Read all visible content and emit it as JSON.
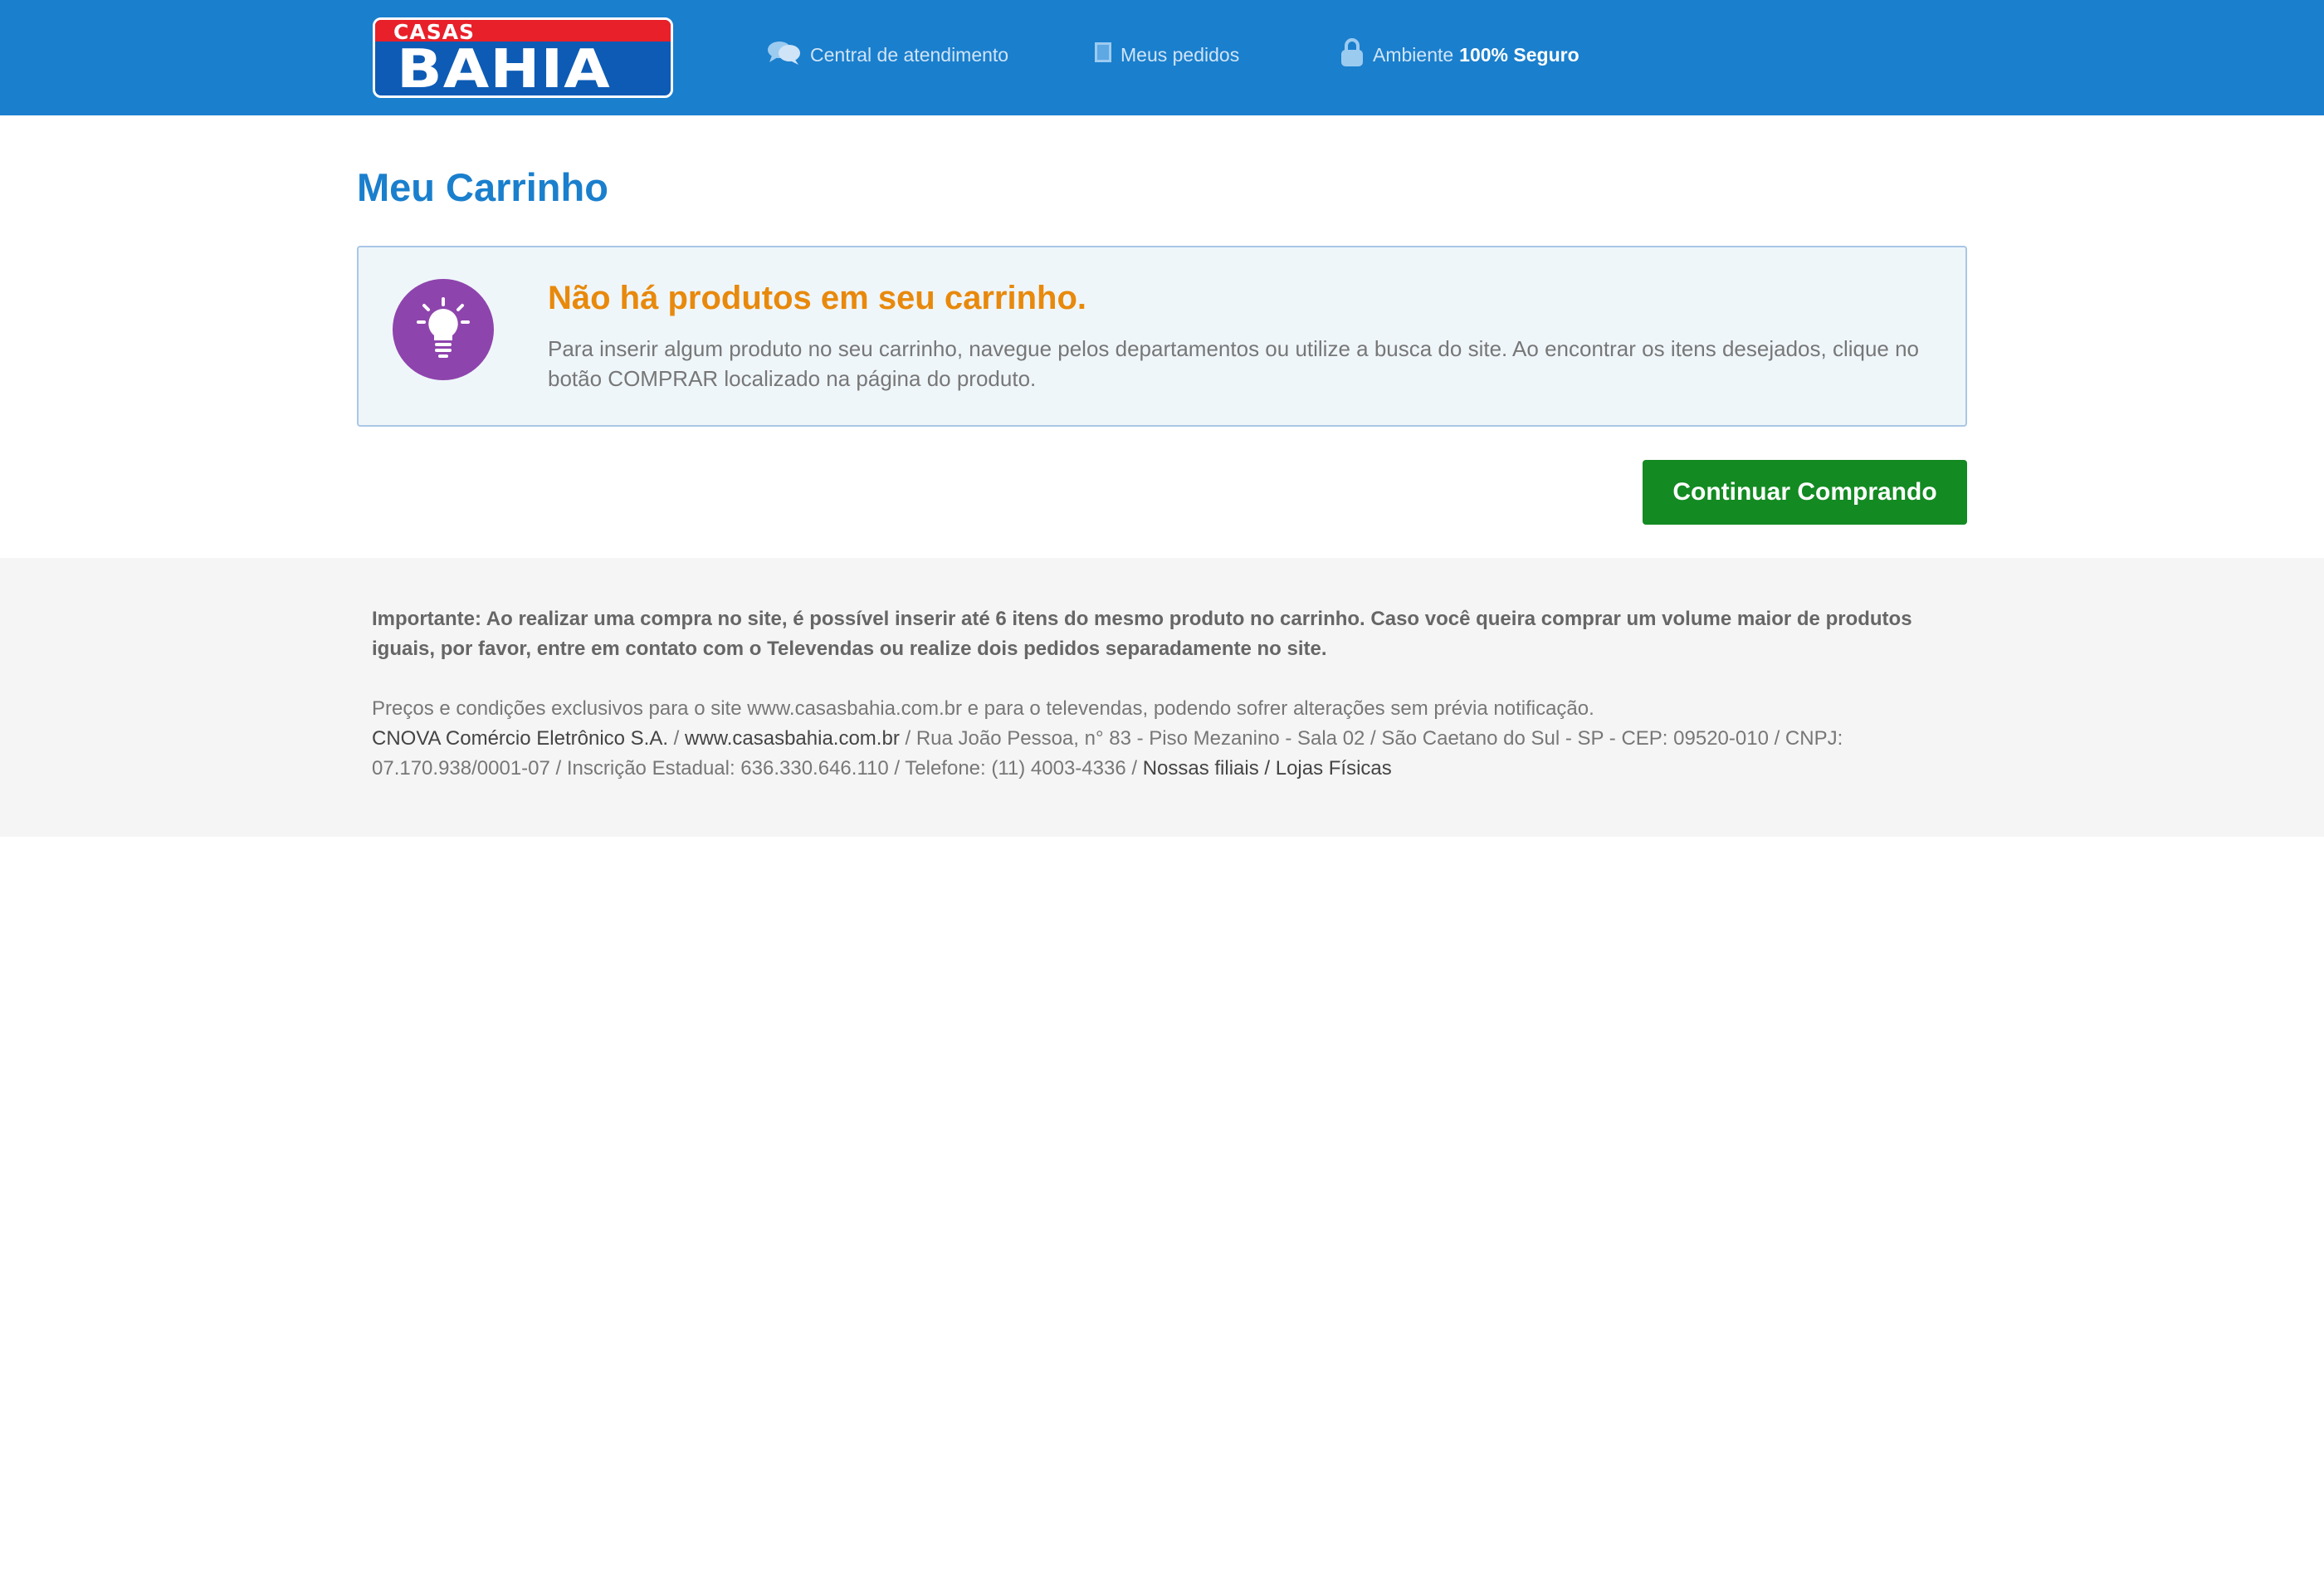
{
  "header": {
    "logo": {
      "top_text": "CASAS",
      "main_text": "BAHIA"
    },
    "links": {
      "atendimento": {
        "label": "Central de atendimento",
        "icon": "chat-bubbles-icon"
      },
      "pedidos": {
        "label": "Meus pedidos",
        "icon": "orders-icon"
      },
      "seguro": {
        "label_prefix": "Ambiente",
        "label_bold": "100% Seguro",
        "icon": "padlock-icon"
      }
    }
  },
  "main": {
    "title": "Meu Carrinho",
    "notice": {
      "icon": "lightbulb-icon",
      "title": "Não há produtos em seu carrinho.",
      "text": "Para inserir algum produto no seu carrinho, navegue pelos departamentos ou utilize a busca do site. Ao encontrar os itens desejados, clique no botão COMPRAR localizado na página do produto."
    },
    "continue_button": "Continuar Comprando"
  },
  "footer": {
    "important": "Importante: Ao realizar uma compra no site, é possível inserir até 6 itens do mesmo produto no carrinho. Caso você queira comprar um volume maior de produtos iguais, por favor, entre em contato com o Televendas ou realize dois pedidos separadamente no site.",
    "prices": "Preços e condições exclusivos para o site www.casasbahia.com.br e para o televendas, podendo sofrer alterações sem prévia notificação.",
    "company_link": "CNOVA Comércio Eletrônico S.A.",
    "sep1": " / ",
    "site_link": "www.casasbahia.com.br",
    "address": " / Rua João Pessoa, n° 83 - Piso Mezanino - Sala 02 / São Caetano do Sul - SP - CEP: 09520-010 / CNPJ: 07.170.938/0001-07 / Inscrição Estadual: 636.330.646.110 / Telefone: (11) 4003-4336 / ",
    "stores_link": "Nossas filiais / Lojas Físicas"
  },
  "colors": {
    "header_bg": "#1a7fcd",
    "title": "#1a7fcd",
    "notice_title": "#e8890c",
    "button_bg": "#138a22",
    "bulb_bg": "#8e44ad"
  }
}
